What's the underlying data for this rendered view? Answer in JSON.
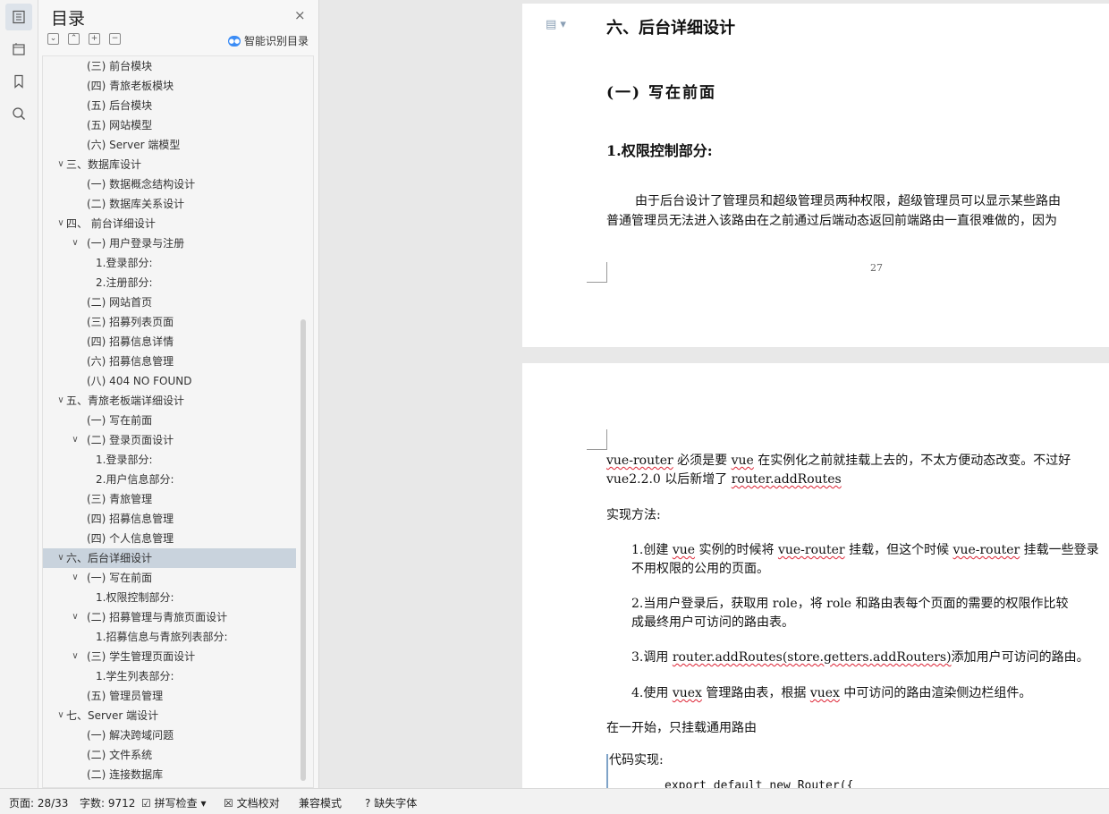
{
  "toc": {
    "title": "目录",
    "close": "×",
    "smart_label": "智能识别目录",
    "items": [
      {
        "text": "(三) 前台模块",
        "level": 2
      },
      {
        "text": "(四) 青旅老板模块",
        "level": 2
      },
      {
        "text": "(五) 后台模块",
        "level": 2
      },
      {
        "text": "(五)   网站模型",
        "level": 2
      },
      {
        "text": "(六) Server 端模型",
        "level": 2
      },
      {
        "text": "三、数据库设计",
        "level": 1,
        "expanded": true
      },
      {
        "text": "(一) 数据概念结构设计",
        "level": 2
      },
      {
        "text": "(二) 数据库关系设计",
        "level": 2
      },
      {
        "text": "四、 前台详细设计",
        "level": 1,
        "expanded": true
      },
      {
        "text": "(一) 用户登录与注册",
        "level": 2,
        "expanded": true
      },
      {
        "text": "1.登录部分:",
        "level": 3
      },
      {
        "text": "2.注册部分:",
        "level": 3
      },
      {
        "text": "(二) 网站首页",
        "level": 2
      },
      {
        "text": "(三) 招募列表页面",
        "level": 2
      },
      {
        "text": "(四) 招募信息详情",
        "level": 2
      },
      {
        "text": "(六) 招募信息管理",
        "level": 2
      },
      {
        "text": "(八) 404 NO FOUND",
        "level": 2
      },
      {
        "text": "五、青旅老板端详细设计",
        "level": 1,
        "expanded": true
      },
      {
        "text": "(一) 写在前面",
        "level": 2
      },
      {
        "text": "(二)   登录页面设计",
        "level": 2,
        "expanded": true
      },
      {
        "text": "1.登录部分:",
        "level": 3
      },
      {
        "text": "2.用户信息部分:",
        "level": 3
      },
      {
        "text": "(三)   青旅管理",
        "level": 2
      },
      {
        "text": "(四)   招募信息管理",
        "level": 2
      },
      {
        "text": "(四)   个人信息管理",
        "level": 2
      },
      {
        "text": "六、后台详细设计",
        "level": 1,
        "expanded": true,
        "selected": true
      },
      {
        "text": "(一) 写在前面",
        "level": 2,
        "expanded": true
      },
      {
        "text": "1.权限控制部分:",
        "level": 3
      },
      {
        "text": "(二)   招募管理与青旅页面设计",
        "level": 2,
        "expanded": true
      },
      {
        "text": "1.招募信息与青旅列表部分:",
        "level": 3
      },
      {
        "text": "(三) 学生管理页面设计",
        "level": 2,
        "expanded": true
      },
      {
        "text": "1.学生列表部分:",
        "level": 3
      },
      {
        "text": "(五) 管理员管理",
        "level": 2
      },
      {
        "text": "七、Server 端设计",
        "level": 1,
        "expanded": true
      },
      {
        "text": "(一) 解决跨域问题",
        "level": 2
      },
      {
        "text": "(二) 文件系统",
        "level": 2
      },
      {
        "text": "(二) 连接数据库",
        "level": 2
      }
    ]
  },
  "doc": {
    "page1": {
      "h1": "六、后台详细设计",
      "h2": "(一) 写在前面",
      "h3": "1.权限控制部分:",
      "line1": "由于后台设计了管理员和超级管理员两种权限，超级管理员可以显示某些路由",
      "line2": "普通管理员无法进入该路由在之前通过后端动态返回前端路由一直很难做的，因为",
      "page_number": "27"
    },
    "page2": {
      "l1_a": "vue-router",
      "l1_b": " 必须是要 ",
      "l1_c": "vue",
      "l1_d": " 在实例化之前就挂载上去的，不太方便动态改变。不过好",
      "l2_a": "vue2.2.0 以后新增了 ",
      "l2_b": "router.addRoutes",
      "method_title": "实现方法:",
      "s1_a": "1.创建 ",
      "s1_b": "vue",
      "s1_c": " 实例的时候将 ",
      "s1_d": "vue-router",
      "s1_e": " 挂载，但这个时候 ",
      "s1_f": "vue-router",
      "s1_g": " 挂载一些登录",
      "s1_line2": "不用权限的公用的页面。",
      "s2_line1": "2.当用户登录后，获取用 role，将 role 和路由表每个页面的需要的权限作比较",
      "s2_line2": "成最终用户可访问的路由表。",
      "s3_a": "3.调用 ",
      "s3_b": "router.addRoutes(store.getters.addRouters)",
      "s3_c": "添加用户可访问的路由。",
      "s4_a": "4.使用 ",
      "s4_b": "vuex",
      "s4_c": " 管理路由表，根据 ",
      "s4_d": "vuex",
      "s4_e": " 中可访问的路由渲染侧边栏组件。",
      "start": "在一开始，只挂载通用路由",
      "code_title": "代码实现:",
      "code_line": "export default new Router({"
    }
  },
  "status": {
    "page": "页面: 28/33",
    "words": "字数: 9712",
    "spell": "拼写检查",
    "proof": "文档校对",
    "compat": "兼容模式",
    "font": "缺失字体"
  }
}
